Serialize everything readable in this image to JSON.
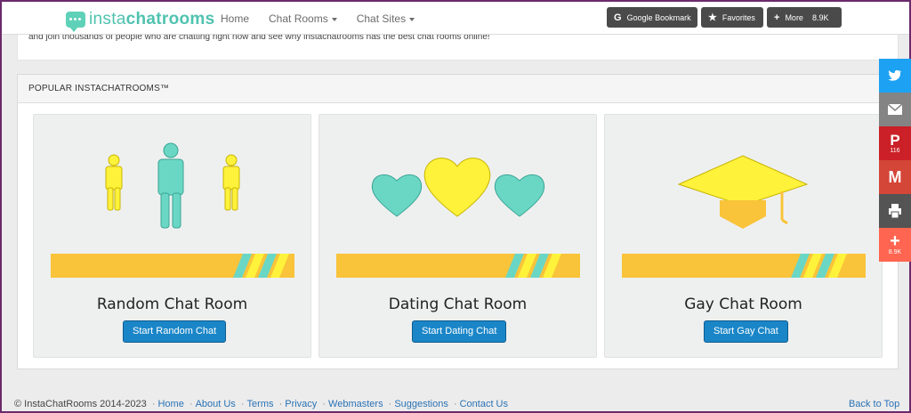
{
  "navbar": {
    "logo_part1": "insta",
    "logo_part2": "chatrooms",
    "links": [
      {
        "label": "Home"
      },
      {
        "label": "Chat Rooms"
      },
      {
        "label": "Chat Sites"
      }
    ]
  },
  "share_bar": {
    "google_label": "Google Bookmark",
    "favorites_label": "Favorites",
    "more_label": "More",
    "more_count": "8.9K"
  },
  "intro": {
    "text": "and join thousands of people who are chatting right now and see why instachatrooms has the best chat rooms online!"
  },
  "panel": {
    "heading": "POPULAR INSTACHATROOMS™",
    "cards": [
      {
        "title": "Random Chat Room",
        "button": "Start Random Chat"
      },
      {
        "title": "Dating Chat Room",
        "button": "Start Dating Chat"
      },
      {
        "title": "Gay Chat Room",
        "button": "Start Gay Chat"
      }
    ]
  },
  "social": {
    "pinterest_count": "116",
    "share_count": "8.9K",
    "colors": {
      "twitter": "#1da1f2",
      "email": "#848484",
      "pinterest": "#cb2027",
      "gmail": "#d44638",
      "print": "#545454",
      "share": "#ff6550"
    }
  },
  "footer": {
    "copyright": "© InstaChatRooms 2014-2023",
    "links": [
      "Home",
      "About Us",
      "Terms",
      "Privacy",
      "Webmasters",
      "Suggestions",
      "Contact Us"
    ],
    "back_to_top": "Back to Top"
  },
  "colors": {
    "teal": "#6ad7c5",
    "yellow": "#fff23b",
    "stripe": "#f9c33a",
    "button": "#1a86c8"
  }
}
